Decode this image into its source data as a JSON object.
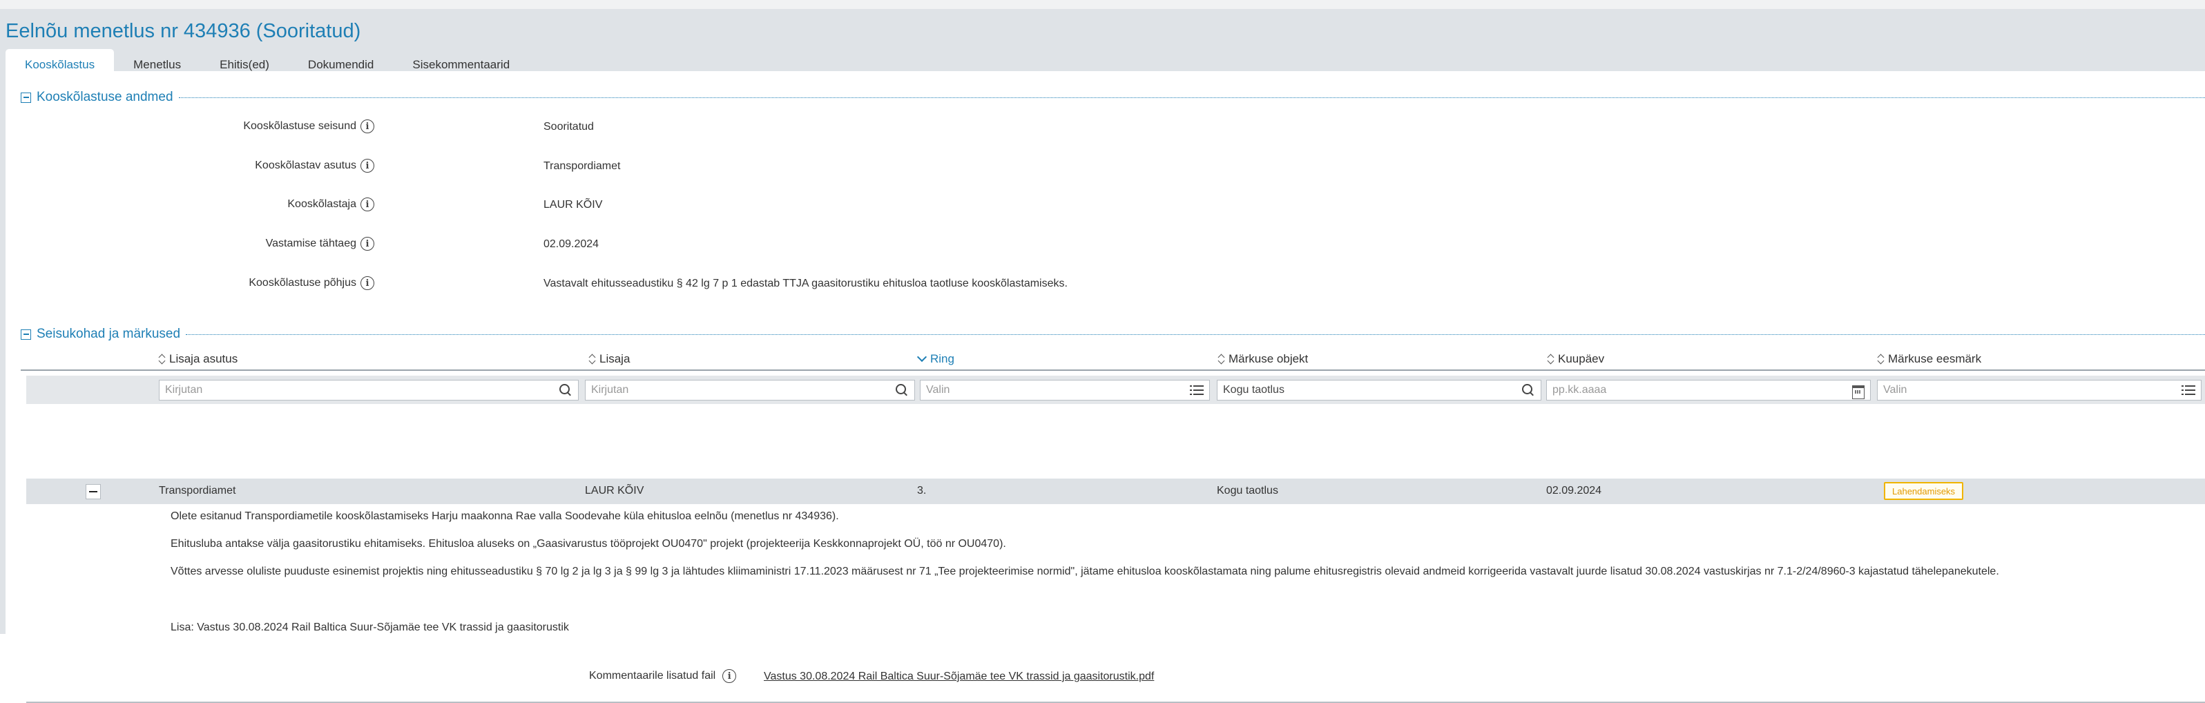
{
  "page": {
    "title": "Eelnõu menetlus nr 434936 (Sooritatud)"
  },
  "tabs": [
    {
      "label": "Kooskõlastus",
      "active": true
    },
    {
      "label": "Menetlus",
      "active": false
    },
    {
      "label": "Ehitis(ed)",
      "active": false
    },
    {
      "label": "Dokumendid",
      "active": false
    },
    {
      "label": "Sisekommentaarid",
      "active": false
    }
  ],
  "approval_section": {
    "title": "Kooskõlastuse andmed",
    "fields": [
      {
        "label": "Kooskõlastuse seisund",
        "value": "Sooritatud"
      },
      {
        "label": "Kooskõlastav asutus",
        "value": "Transpordiamet"
      },
      {
        "label": "Kooskõlastaja",
        "value": "LAUR KÕIV"
      },
      {
        "label": "Vastamise tähtaeg",
        "value": "02.09.2024"
      },
      {
        "label": "Kooskõlastuse põhjus",
        "value": "Vastavalt ehitusseadustiku § 42 lg 7 p 1 edastab TTJA gaasitorustiku ehitusloa taotluse kooskõlastamiseks."
      }
    ]
  },
  "remarks_section": {
    "title": "Seisukohad ja märkused",
    "columns": [
      {
        "label": "Lisaja asutus",
        "sort": "none"
      },
      {
        "label": "Lisaja",
        "sort": "none"
      },
      {
        "label": "Ring",
        "sort": "desc"
      },
      {
        "label": "Märkuse objekt",
        "sort": "none"
      },
      {
        "label": "Kuupäev",
        "sort": "none"
      },
      {
        "label": "Märkuse eesmärk",
        "sort": "none"
      }
    ],
    "filters": [
      {
        "placeholder": "Kirjutan",
        "icon": "search-icon"
      },
      {
        "placeholder": "Kirjutan",
        "icon": "search-icon"
      },
      {
        "placeholder": "Valin",
        "icon": "list-icon"
      },
      {
        "value": "Kogu taotlus",
        "icon": "search-icon"
      },
      {
        "placeholder": "pp.kk.aaaa",
        "icon": "calendar-icon"
      },
      {
        "placeholder": "Valin",
        "icon": "list-icon"
      }
    ],
    "row": {
      "institution": "Transpordiamet",
      "author": "LAUR KÕIV",
      "round": "3.",
      "object": "Kogu taotlus",
      "date": "02.09.2024",
      "purpose": "Lahendamiseks"
    },
    "detail": {
      "paragraphs": [
        "Olete esitanud Transpordiametile kooskõlastamiseks Harju maakonna Rae valla Soodevahe küla ehitusloa eelnõu (menetlus nr 434936).",
        "Ehitusluba antakse välja gaasitorustiku ehitamiseks. Ehitusloa aluseks on „Gaasivarustus tööprojekt OU0470\" projekt (projekteerija Keskkonnaprojekt OÜ, töö nr OU0470).",
        "Võttes arvesse oluliste puuduste esinemist projektis ning ehitusseadustiku § 70 lg 2 ja lg 3 ja § 99 lg 3 ja lähtudes kliimaministri 17.11.2023 määrusest nr 71 „Tee projekteerimise normid\", jätame ehitusloa kooskõlastamata ning palume ehitusregistris olevaid andmeid korrigeerida vastavalt juurde lisatud 30.08.2024 vastuskirjas nr 7.1-2/24/8960-3 kajastatud tähelepanekutele.",
        "Lisa: Vastus 30.08.2024 Rail Baltica Suur-Sõjamäe tee VK trassid ja gaasitorustik"
      ],
      "attachment_label": "Kommentaarile lisatud fail",
      "attachment_file": "Vastus 30.08.2024 Rail Baltica Suur-Sõjamäe tee VK trassid ja gaasitorustik.pdf"
    }
  },
  "colors": {
    "accent": "#1e7fb5",
    "header_bg": "#dfe3e7",
    "badge_border": "#f0b400",
    "badge_text": "#e39a00"
  }
}
